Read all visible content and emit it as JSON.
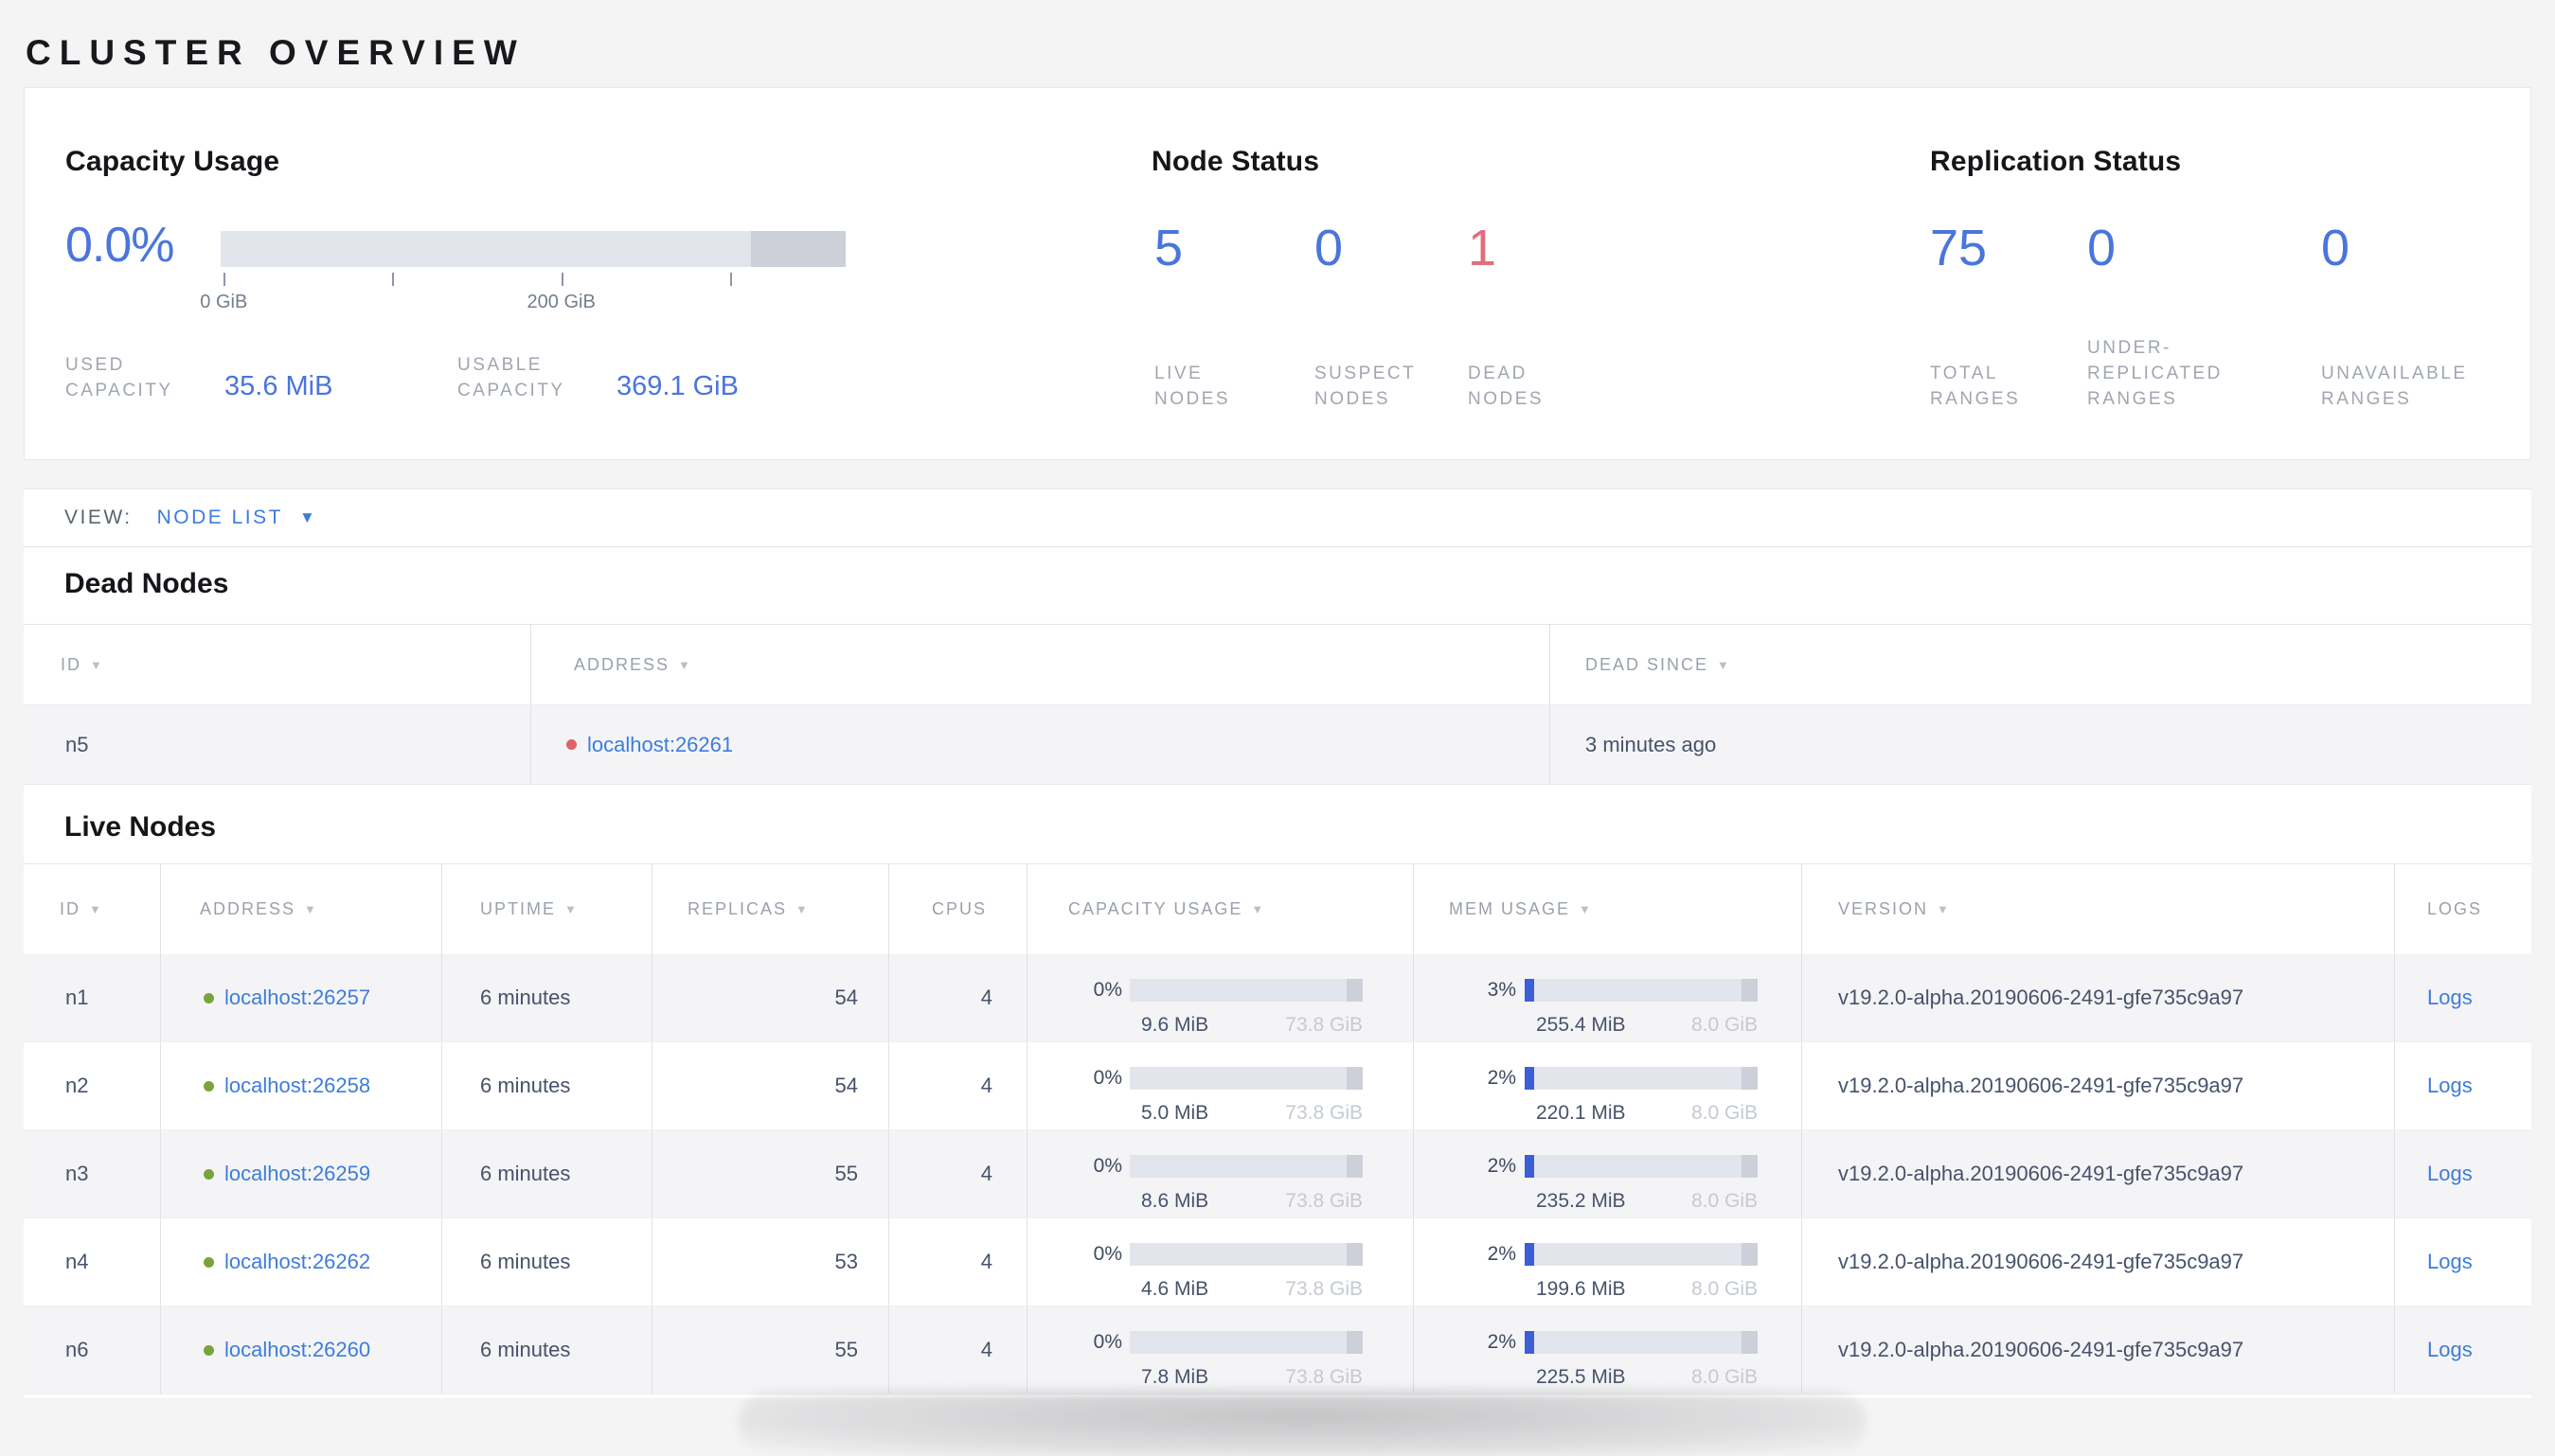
{
  "page": {
    "title": "CLUSTER OVERVIEW"
  },
  "colors": {
    "accent_blue": "#4a75dc",
    "link_blue": "#3e7cdb",
    "dead_red": "#e06e7e",
    "dead_dot_red": "#e0606b",
    "live_dot_green": "#78a53a",
    "bar_used_blue": "#3c5fd7",
    "bar_track": "#e3e5ec",
    "bar_other": "#cdd0d9"
  },
  "summary": {
    "capacity": {
      "heading": "Capacity Usage",
      "percent": "0.0%",
      "meter": {
        "used_pct": 0,
        "other_pct": 15.2,
        "ticks": [
          {
            "pct": 0.5,
            "label": "0 GiB"
          },
          {
            "pct": 27.4,
            "label": ""
          },
          {
            "pct": 54.5,
            "label": "200 GiB"
          },
          {
            "pct": 81.5,
            "label": ""
          }
        ]
      },
      "stats": [
        {
          "label": "USED\nCAPACITY",
          "value": "35.6 MiB"
        },
        {
          "label": "USABLE\nCAPACITY",
          "value": "369.1 GiB"
        }
      ]
    },
    "node_status": {
      "heading": "Node Status",
      "stats": [
        {
          "value": "5",
          "label": "LIVE\nNODES",
          "tone": "blue"
        },
        {
          "value": "0",
          "label": "SUSPECT\nNODES",
          "tone": "blue"
        },
        {
          "value": "1",
          "label": "DEAD\nNODES",
          "tone": "red"
        }
      ]
    },
    "replication": {
      "heading": "Replication Status",
      "stats": [
        {
          "value": "75",
          "label": "TOTAL\nRANGES",
          "tone": "blue"
        },
        {
          "value": "0",
          "label": "UNDER-\nREPLICATED\nRANGES",
          "tone": "blue"
        },
        {
          "value": "0",
          "label": "UNAVAILABLE\nRANGES",
          "tone": "blue"
        }
      ]
    }
  },
  "view_bar": {
    "label": "VIEW:",
    "value": "NODE LIST",
    "caret": "▼"
  },
  "dead_nodes": {
    "heading": "Dead Nodes",
    "columns": [
      {
        "label": "ID",
        "sortable": true
      },
      {
        "label": "ADDRESS",
        "sortable": true
      },
      {
        "label": "DEAD SINCE",
        "sortable": true
      }
    ],
    "rows": [
      {
        "id": "n5",
        "address": "localhost:26261",
        "status": "dead",
        "dead_since": "3 minutes ago"
      }
    ]
  },
  "live_nodes": {
    "heading": "Live Nodes",
    "columns": [
      {
        "label": "ID",
        "sortable": true
      },
      {
        "label": "ADDRESS",
        "sortable": true
      },
      {
        "label": "UPTIME",
        "sortable": true
      },
      {
        "label": "REPLICAS",
        "sortable": true
      },
      {
        "label": "CPUS",
        "sortable": false
      },
      {
        "label": "CAPACITY USAGE",
        "sortable": true
      },
      {
        "label": "MEM USAGE",
        "sortable": true
      },
      {
        "label": "VERSION",
        "sortable": true
      },
      {
        "label": "LOGS",
        "sortable": false
      }
    ],
    "rows": [
      {
        "id": "n1",
        "address": "localhost:26257",
        "status": "live",
        "uptime": "6 minutes",
        "replicas": "54",
        "cpus": "4",
        "capacity": {
          "percent": "0%",
          "used": "9.6 MiB",
          "total": "73.8 GiB",
          "used_pct": 0
        },
        "memory": {
          "percent": "3%",
          "used": "255.4 MiB",
          "total": "8.0 GiB",
          "used_pct": 3
        },
        "version": "v19.2.0-alpha.20190606-2491-gfe735c9a97",
        "logs_label": "Logs"
      },
      {
        "id": "n2",
        "address": "localhost:26258",
        "status": "live",
        "uptime": "6 minutes",
        "replicas": "54",
        "cpus": "4",
        "capacity": {
          "percent": "0%",
          "used": "5.0 MiB",
          "total": "73.8 GiB",
          "used_pct": 0
        },
        "memory": {
          "percent": "2%",
          "used": "220.1 MiB",
          "total": "8.0 GiB",
          "used_pct": 2
        },
        "version": "v19.2.0-alpha.20190606-2491-gfe735c9a97",
        "logs_label": "Logs"
      },
      {
        "id": "n3",
        "address": "localhost:26259",
        "status": "live",
        "uptime": "6 minutes",
        "replicas": "55",
        "cpus": "4",
        "capacity": {
          "percent": "0%",
          "used": "8.6 MiB",
          "total": "73.8 GiB",
          "used_pct": 0
        },
        "memory": {
          "percent": "2%",
          "used": "235.2 MiB",
          "total": "8.0 GiB",
          "used_pct": 2
        },
        "version": "v19.2.0-alpha.20190606-2491-gfe735c9a97",
        "logs_label": "Logs"
      },
      {
        "id": "n4",
        "address": "localhost:26262",
        "status": "live",
        "uptime": "6 minutes",
        "replicas": "53",
        "cpus": "4",
        "capacity": {
          "percent": "0%",
          "used": "4.6 MiB",
          "total": "73.8 GiB",
          "used_pct": 0
        },
        "memory": {
          "percent": "2%",
          "used": "199.6 MiB",
          "total": "8.0 GiB",
          "used_pct": 2
        },
        "version": "v19.2.0-alpha.20190606-2491-gfe735c9a97",
        "logs_label": "Logs"
      },
      {
        "id": "n6",
        "address": "localhost:26260",
        "status": "live",
        "uptime": "6 minutes",
        "replicas": "55",
        "cpus": "4",
        "capacity": {
          "percent": "0%",
          "used": "7.8 MiB",
          "total": "73.8 GiB",
          "used_pct": 0
        },
        "memory": {
          "percent": "2%",
          "used": "225.5 MiB",
          "total": "8.0 GiB",
          "used_pct": 2
        },
        "version": "v19.2.0-alpha.20190606-2491-gfe735c9a97",
        "logs_label": "Logs"
      }
    ]
  }
}
